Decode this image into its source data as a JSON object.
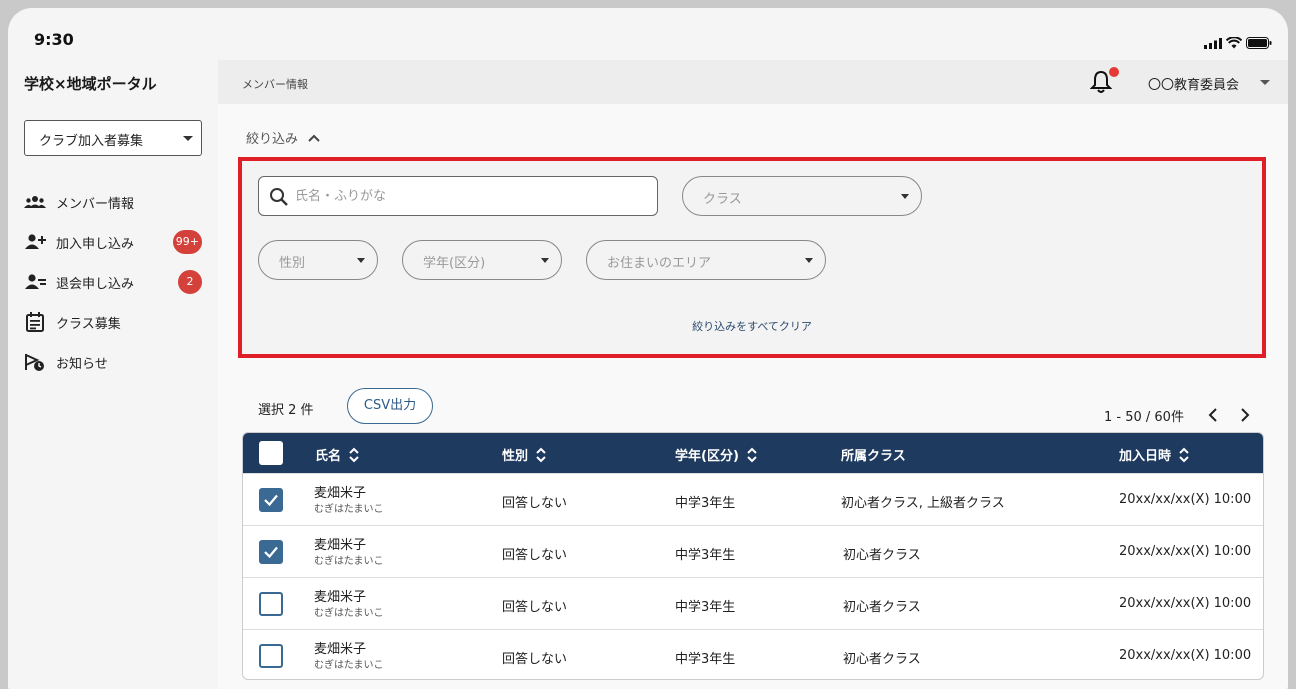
{
  "status": {
    "time": "9:30"
  },
  "sidebar": {
    "app_title": "学校×地域ポータル",
    "select": {
      "value": "クラブ加入者募集"
    },
    "items": [
      {
        "label": "メンバー情報",
        "icon": "group-icon",
        "badge": ""
      },
      {
        "label": "加入申し込み",
        "icon": "person-add-icon",
        "badge": "99+"
      },
      {
        "label": "退会申し込み",
        "icon": "person-remove-icon",
        "badge": "2"
      },
      {
        "label": "クラス募集",
        "icon": "calendar-list-icon",
        "badge": ""
      },
      {
        "label": "お知らせ",
        "icon": "notice-clock-icon",
        "badge": ""
      }
    ]
  },
  "topbar": {
    "breadcrumb": "メンバー情報",
    "org": "〇〇教育委員会"
  },
  "filters": {
    "toggle_label": "絞り込み",
    "search_placeholder": "氏名・ふりがな",
    "class_placeholder": "クラス",
    "gender_placeholder": "性別",
    "grade_placeholder": "学年(区分)",
    "area_placeholder": "お住まいのエリア",
    "clear_label": "絞り込みをすべてクリア"
  },
  "toolbar": {
    "selected_count": "選択 2 件",
    "csv_label": "CSV出力",
    "pagination": "1 - 50 / 60件"
  },
  "table": {
    "columns": [
      "氏名",
      "性別",
      "学年(区分)",
      "所属クラス",
      "加入日時"
    ],
    "rows": [
      {
        "checked": true,
        "name": "麦畑米子",
        "kana": "むぎはたまいこ",
        "gender": "回答しない",
        "grade": "中学3年生",
        "class": "初心者クラス, 上級者クラス",
        "joined": "20xx/xx/xx(X) 10:00"
      },
      {
        "checked": true,
        "name": "麦畑米子",
        "kana": "むぎはたまいこ",
        "gender": "回答しない",
        "grade": "中学3年生",
        "class": "初心者クラス",
        "joined": "20xx/xx/xx(X) 10:00"
      },
      {
        "checked": false,
        "name": "麦畑米子",
        "kana": "むぎはたまいこ",
        "gender": "回答しない",
        "grade": "中学3年生",
        "class": "初心者クラス",
        "joined": "20xx/xx/xx(X) 10:00"
      },
      {
        "checked": false,
        "name": "麦畑米子",
        "kana": "むぎはたまいこ",
        "gender": "回答しない",
        "grade": "中学3年生",
        "class": "初心者クラス",
        "joined": "20xx/xx/xx(X) 10:00"
      }
    ]
  },
  "colors": {
    "accent": "#1f3a5f",
    "highlight": "#e01e28",
    "badge": "#d4403a",
    "checkbox": "#3a6a93"
  }
}
